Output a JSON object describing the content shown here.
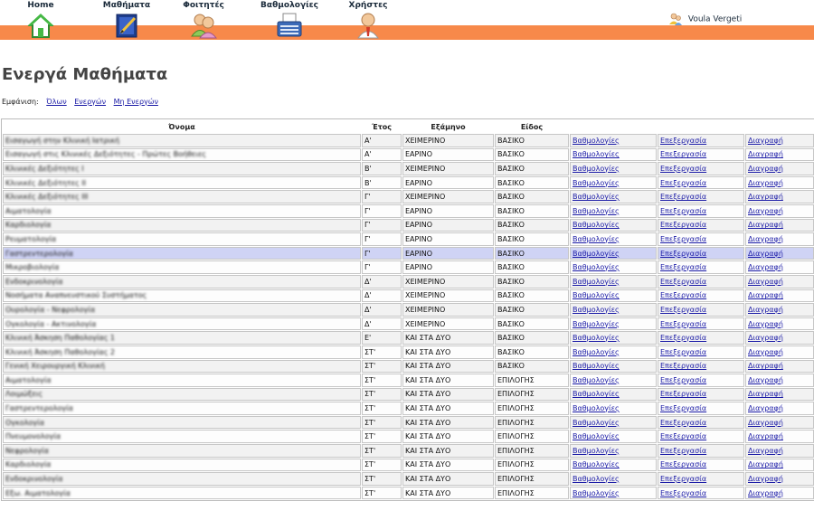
{
  "nav": [
    {
      "label": "Home",
      "icon": "home-icon"
    },
    {
      "label": "Μαθήματα",
      "icon": "courses-icon"
    },
    {
      "label": "Φοιτητές",
      "icon": "students-icon"
    },
    {
      "label": "Βαθμολογίες",
      "icon": "grades-icon"
    },
    {
      "label": "Χρήστες",
      "icon": "users-icon"
    }
  ],
  "user": {
    "name": "Voula Vergeti",
    "icon": "user-icon"
  },
  "page_title": "Ενεργά Μαθήματα",
  "filter": {
    "label": "Εμφάνιση:",
    "all": "Όλων",
    "active": "Ενεργών",
    "inactive": "Μη Ενεργών"
  },
  "table": {
    "headers": {
      "name": "Όνομα",
      "year": "Έτος",
      "semester": "Εξάμηνο",
      "type": "Είδος"
    },
    "link_labels": {
      "grades": "Βαθμολογίες",
      "edit": "Επεξεργασία",
      "delete": "Διαγραφή"
    },
    "rows": [
      {
        "name": "Εισαγωγή στην Κλινική Ιατρική",
        "year": "Α'",
        "semester": "ΧΕΙΜΕΡΙΝΟ",
        "type": "ΒΑΣΙΚΟ"
      },
      {
        "name": "Εισαγωγή στις Κλινικές Δεξιότητες - Πρώτες Βοήθειες",
        "year": "Α'",
        "semester": "ΕΑΡΙΝΟ",
        "type": "ΒΑΣΙΚΟ"
      },
      {
        "name": "Κλινικές Δεξιότητες Ι",
        "year": "Β'",
        "semester": "ΧΕΙΜΕΡΙΝΟ",
        "type": "ΒΑΣΙΚΟ"
      },
      {
        "name": "Κλινικές Δεξιότητες ΙΙ",
        "year": "Β'",
        "semester": "ΕΑΡΙΝΟ",
        "type": "ΒΑΣΙΚΟ"
      },
      {
        "name": "Κλινικές Δεξιότητες ΙΙΙ",
        "year": "Γ'",
        "semester": "ΧΕΙΜΕΡΙΝΟ",
        "type": "ΒΑΣΙΚΟ"
      },
      {
        "name": "Αιματολογία",
        "year": "Γ'",
        "semester": "ΕΑΡΙΝΟ",
        "type": "ΒΑΣΙΚΟ"
      },
      {
        "name": "Καρδιολογία",
        "year": "Γ'",
        "semester": "ΕΑΡΙΝΟ",
        "type": "ΒΑΣΙΚΟ"
      },
      {
        "name": "Ρευματολογία",
        "year": "Γ'",
        "semester": "ΕΑΡΙΝΟ",
        "type": "ΒΑΣΙΚΟ"
      },
      {
        "name": "Γαστρεντερολογία",
        "year": "Γ'",
        "semester": "ΕΑΡΙΝΟ",
        "type": "ΒΑΣΙΚΟ"
      },
      {
        "name": "Μικροβιολογία",
        "year": "Γ'",
        "semester": "ΕΑΡΙΝΟ",
        "type": "ΒΑΣΙΚΟ"
      },
      {
        "name": "Ενδοκρινολογία",
        "year": "Δ'",
        "semester": "ΧΕΙΜΕΡΙΝΟ",
        "type": "ΒΑΣΙΚΟ"
      },
      {
        "name": "Νοσήματα Αναπνευστικού Συστήματος",
        "year": "Δ'",
        "semester": "ΧΕΙΜΕΡΙΝΟ",
        "type": "ΒΑΣΙΚΟ"
      },
      {
        "name": "Ουρολογία - Νεφρολογία",
        "year": "Δ'",
        "semester": "ΧΕΙΜΕΡΙΝΟ",
        "type": "ΒΑΣΙΚΟ"
      },
      {
        "name": "Ογκολογία - Ακτινολογία",
        "year": "Δ'",
        "semester": "ΧΕΙΜΕΡΙΝΟ",
        "type": "ΒΑΣΙΚΟ"
      },
      {
        "name": "Κλινική Άσκηση Παθολογίας 1",
        "year": "Ε'",
        "semester": "ΚΑΙ ΣΤΑ ΔΥΟ",
        "type": "ΒΑΣΙΚΟ"
      },
      {
        "name": "Κλινική Άσκηση Παθολογίας 2",
        "year": "ΣΤ'",
        "semester": "ΚΑΙ ΣΤΑ ΔΥΟ",
        "type": "ΒΑΣΙΚΟ"
      },
      {
        "name": "Γενική Χειρουργική Κλινική",
        "year": "ΣΤ'",
        "semester": "ΚΑΙ ΣΤΑ ΔΥΟ",
        "type": "ΒΑΣΙΚΟ"
      },
      {
        "name": "Αιματολογία",
        "year": "ΣΤ'",
        "semester": "ΚΑΙ ΣΤΑ ΔΥΟ",
        "type": "ΕΠΙΛΟΓΗΣ"
      },
      {
        "name": "Λοιμώξεις",
        "year": "ΣΤ'",
        "semester": "ΚΑΙ ΣΤΑ ΔΥΟ",
        "type": "ΕΠΙΛΟΓΗΣ"
      },
      {
        "name": "Γαστρεντερολογία",
        "year": "ΣΤ'",
        "semester": "ΚΑΙ ΣΤΑ ΔΥΟ",
        "type": "ΕΠΙΛΟΓΗΣ"
      },
      {
        "name": "Ογκολογία",
        "year": "ΣΤ'",
        "semester": "ΚΑΙ ΣΤΑ ΔΥΟ",
        "type": "ΕΠΙΛΟΓΗΣ"
      },
      {
        "name": "Πνευμονολογία",
        "year": "ΣΤ'",
        "semester": "ΚΑΙ ΣΤΑ ΔΥΟ",
        "type": "ΕΠΙΛΟΓΗΣ"
      },
      {
        "name": "Νεφρολογία",
        "year": "ΣΤ'",
        "semester": "ΚΑΙ ΣΤΑ ΔΥΟ",
        "type": "ΕΠΙΛΟΓΗΣ"
      },
      {
        "name": "Καρδιολογία",
        "year": "ΣΤ'",
        "semester": "ΚΑΙ ΣΤΑ ΔΥΟ",
        "type": "ΕΠΙΛΟΓΗΣ"
      },
      {
        "name": "Ενδοκρινολογία",
        "year": "ΣΤ'",
        "semester": "ΚΑΙ ΣΤΑ ΔΥΟ",
        "type": "ΕΠΙΛΟΓΗΣ"
      },
      {
        "name": "Εξω. Αιματολογία",
        "year": "ΣΤ'",
        "semester": "ΚΑΙ ΣΤΑ ΔΥΟ",
        "type": "ΕΠΙΛΟΓΗΣ"
      }
    ]
  },
  "colors": {
    "nav_bar": "#f7894a",
    "link": "#1a1aa6",
    "highlight_row": "#cfd3f5"
  }
}
